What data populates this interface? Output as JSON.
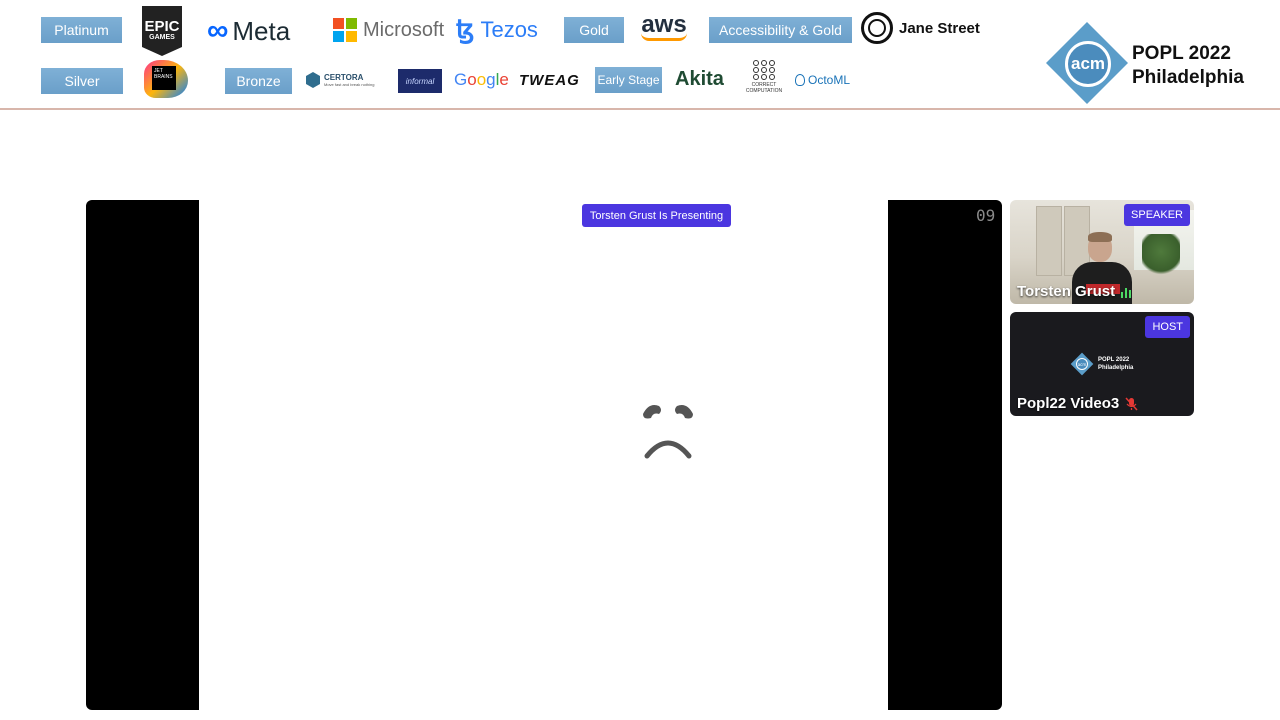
{
  "sponsors": {
    "tiers": {
      "platinum": "Platinum",
      "gold": "Gold",
      "accessibility_gold": "Accessibility & Gold",
      "silver": "Silver",
      "bronze": "Bronze",
      "early_stage": "Early Stage"
    },
    "logos": {
      "epic_line1": "EPIC",
      "epic_line2": "GAMES",
      "meta": "Meta",
      "microsoft": "Microsoft",
      "tezos": "Tezos",
      "aws": "aws",
      "jane_street": "Jane Street",
      "jetbrains": "JET BRAINS",
      "certora": "CERTORA",
      "certora_tagline": "Move fast and break nothing",
      "informal": "informal",
      "google": [
        "G",
        "o",
        "o",
        "g",
        "l",
        "e"
      ],
      "tweag": "TWEAG",
      "akita": "Akita",
      "correct_computation": "CORRECT COMPUTATION",
      "octoml": "OctoML"
    }
  },
  "conference": {
    "logo_text": "acm",
    "title_line1": "POPL 2022",
    "title_line2": "Philadelphia"
  },
  "stage": {
    "presenting_badge": "Torsten Grust Is Presenting",
    "slide_number": "09",
    "slide_icon": "sad-face-icon"
  },
  "participants": [
    {
      "role": "SPEAKER",
      "name": "Torsten Grust",
      "audio": "speaking"
    },
    {
      "role": "HOST",
      "name": "Popl22 Video3",
      "audio": "muted",
      "logo_line1": "POPL 2022",
      "logo_line2": "Philadelphia",
      "logo_text": "acm"
    }
  ],
  "colors": {
    "accent": "#4b36e0",
    "tier_badge": "#6a9fc9",
    "banner_border": "#d8b6ab",
    "muted": "#e53935",
    "audio_active": "#4cd964"
  }
}
